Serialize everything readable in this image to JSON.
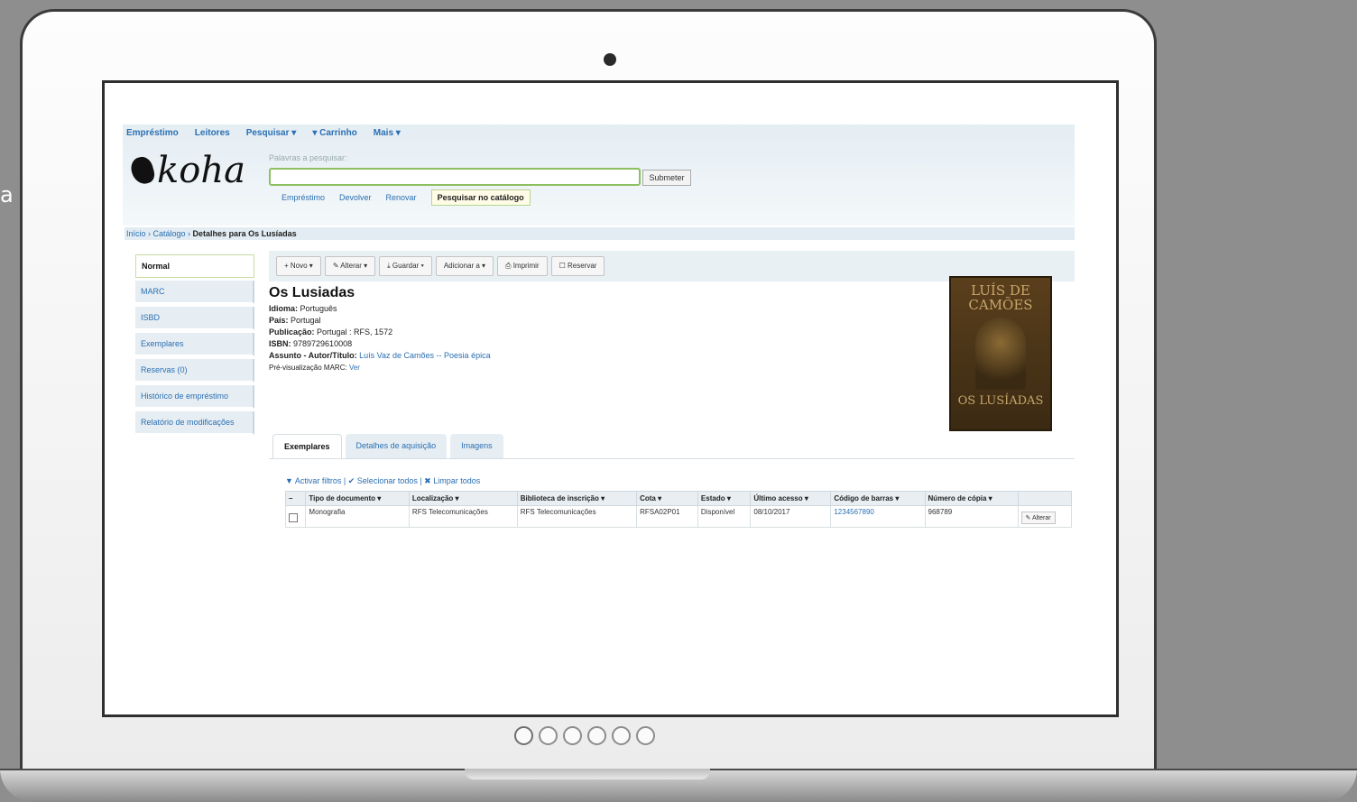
{
  "stray_char": "a",
  "koha": {
    "nav": [
      "Empréstimo",
      "Leitores",
      "Pesquisar ▾",
      "▾ Carrinho",
      "Mais ▾"
    ],
    "logo_text": "koha",
    "search": {
      "label": "Palavras a pesquisar:",
      "value": "",
      "submit": "Submeter",
      "tabs": [
        "Empréstimo",
        "Devolver",
        "Renovar",
        "Pesquisar no catálogo"
      ]
    },
    "breadcrumb": {
      "links": "Início › Catálogo › ",
      "current": "Detalhes para Os Lusíadas"
    },
    "sidebar": [
      "Normal",
      "MARC",
      "ISBD",
      "Exemplares",
      "Reservas (0)",
      "Histórico de empréstimo",
      "Relatório de modificações"
    ],
    "toolbar": [
      "+ Novo ▾",
      "✎ Alterar ▾",
      "⤓ Guardar ▾",
      "Adicionar a ▾",
      "⎙ Imprimir",
      "☐ Reservar"
    ],
    "record": {
      "title": "Os Lusiadas",
      "language_label": "Idioma:",
      "language": "Português",
      "country_label": "País:",
      "country": "Portugal",
      "publication_label": "Publicação:",
      "publication": "Portugal : RFS, 1572",
      "isbn_label": "ISBN:",
      "isbn": "9789729610008",
      "author_label": "Assunto - Autor/Título:",
      "author": "Luís Vaz de Camões -- Poesia épica",
      "marc_preview_label": "Pré-visualização MARC:",
      "marc_preview": "Ver"
    },
    "cover": {
      "top": "LUÍS DE CAMÕES",
      "bottom": "OS LUSÍADAS"
    },
    "item_tabs": [
      "Exemplares",
      "Detalhes de aquisição",
      "Imagens"
    ],
    "filter_links": "▼ Activar filtros | ✔ Selecionar todos | ✖ Limpar todos",
    "table": {
      "headers": [
        "Tipo de documento ▾",
        "Localização ▾",
        "Biblioteca de inscrição ▾",
        "Cota ▾",
        "Estado ▾",
        "Último acesso ▾",
        "Código de barras ▾",
        "Número de cópia ▾"
      ],
      "rows": [
        [
          "Monografia",
          "RFS Telecomunicações",
          "RFS Telecomunicações",
          "RFSA02P01",
          "Disponível",
          "08/10/2017",
          "1234567890",
          "968789"
        ]
      ],
      "edit": "✎ Alterar"
    }
  }
}
